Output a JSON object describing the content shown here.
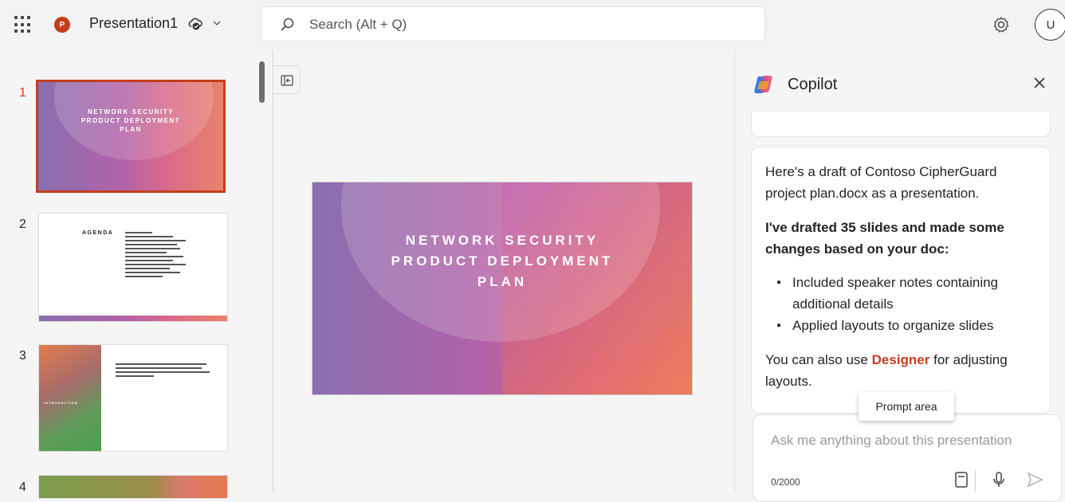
{
  "header": {
    "app_icon_letter": "P",
    "doc_title": "Presentation1",
    "search_placeholder": "Search (Alt + Q)",
    "avatar_initial": "U"
  },
  "thumbnails": [
    {
      "number": "1",
      "title": "NETWORK SECURITY PRODUCT DEPLOYMENT PLAN"
    },
    {
      "number": "2",
      "title": "AGENDA"
    },
    {
      "number": "3",
      "title": "INTRODUCTION"
    },
    {
      "number": "4",
      "title": ""
    }
  ],
  "main_slide": {
    "line1": "NETWORK SECURITY",
    "line2": "PRODUCT DEPLOYMENT",
    "line3": "PLAN"
  },
  "copilot": {
    "title": "Copilot",
    "intro": "Here's a draft of Contoso CipherGuard project plan.docx as a presentation.",
    "summary": "I've drafted 35 slides and made some changes based on your doc:",
    "bullets": [
      "Included speaker notes containing additional details",
      "Applied layouts to organize slides"
    ],
    "designer_prefix": "You can also use",
    "designer_link": "Designer",
    "designer_suffix": "for adjusting layouts.",
    "tooltip": "Prompt area",
    "prompt_placeholder": "Ask me anything about this presentation",
    "counter": "0/2000"
  },
  "colors": {
    "accent": "#c43e1c",
    "slide_gradient": [
      "#8a6fb0",
      "#b262a8",
      "#e9836a"
    ]
  }
}
